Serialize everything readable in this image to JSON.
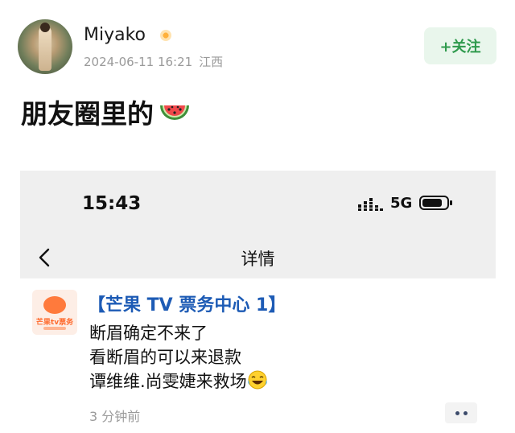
{
  "post": {
    "username": "Miyako",
    "timestamp": "2024-06-11 16:21",
    "location": "江西",
    "follow_label": "+关注",
    "text": "朋友圈里的",
    "emoji": "watermelon-icon"
  },
  "screenshot": {
    "status_time": "15:43",
    "network": "5G",
    "nav_title": "详情",
    "message": {
      "source": "【芒果 TV 票务中心 1】",
      "logo_text": "芒果tv票务",
      "lines": [
        "断眉确定不来了",
        "看断眉的可以来退款",
        "谭维维.尚雯婕来救场"
      ],
      "time": "3 分钟前"
    }
  },
  "colors": {
    "follow_bg": "#e9f6ec",
    "follow_text": "#2f9a4d",
    "source_text": "#1d5bb5",
    "muted": "#9a9a9a"
  }
}
